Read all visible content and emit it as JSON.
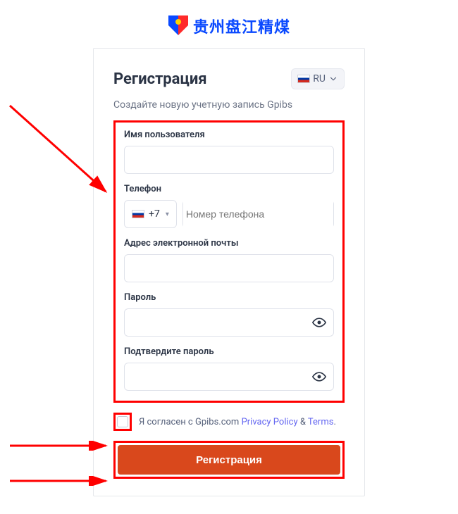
{
  "brand": {
    "text": "贵州盘江精煤"
  },
  "lang": {
    "code": "RU"
  },
  "title": "Регистрация",
  "subtitle": "Создайте новую учетную запись Gpibs",
  "fields": {
    "username": {
      "label": "Имя пользователя"
    },
    "phone": {
      "label": "Телефон",
      "dial": "+7",
      "placeholder": "Номер телефона"
    },
    "email": {
      "label": "Адрес электронной почты"
    },
    "password": {
      "label": "Пароль"
    },
    "confirm": {
      "label": "Подтвердите пароль"
    }
  },
  "terms": {
    "prefix": "Я согласен с Gpibs.com ",
    "privacy": "Privacy Policy",
    "sep": " & ",
    "terms": "Terms",
    "suffix": "."
  },
  "submit": "Регистрация"
}
